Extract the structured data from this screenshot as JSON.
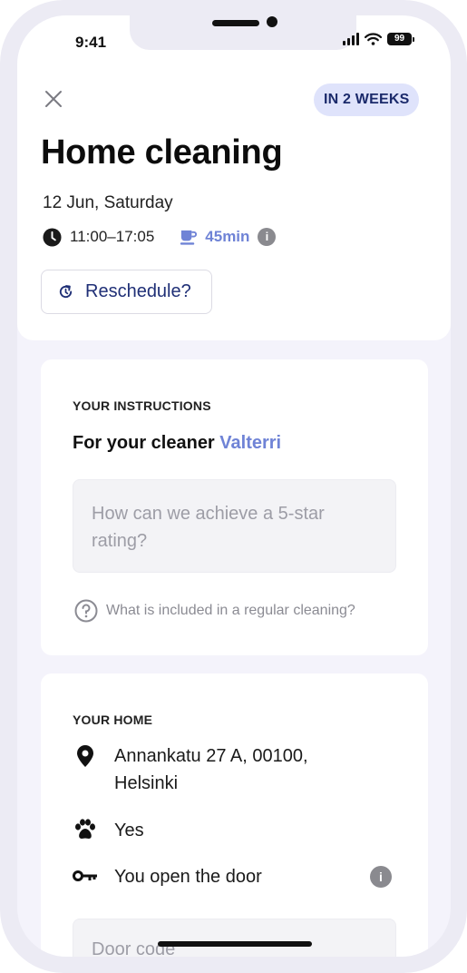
{
  "status_bar": {
    "time": "9:41",
    "battery": "99"
  },
  "header": {
    "badge": "IN 2 WEEKS",
    "title": "Home cleaning",
    "date": "12 Jun, Saturday",
    "time_range": "11:00–17:05",
    "break_duration": "45min",
    "reschedule_label": "Reschedule?"
  },
  "instructions": {
    "section_label": "YOUR INSTRUCTIONS",
    "for_cleaner_prefix": "For your cleaner",
    "cleaner_name": "Valterri",
    "placeholder": "How can we achieve a 5-star rating?",
    "help_link": "What is included in a regular cleaning?"
  },
  "home": {
    "section_label": "YOUR HOME",
    "address": "Annankatu 27 A, 00100, Helsinki",
    "pets": "Yes",
    "access": "You open the door",
    "door_code_placeholder": "Door code"
  },
  "colors": {
    "accent": "#6f83d6",
    "badge_bg": "#dfe3fb",
    "badge_text": "#1b2a6b",
    "button_text": "#1f2f76"
  },
  "icons": [
    "close-icon",
    "clock-icon",
    "coffee-cup-icon",
    "info-icon",
    "refresh-icon",
    "question-circle-icon",
    "location-pin-icon",
    "paw-icon",
    "key-icon"
  ]
}
